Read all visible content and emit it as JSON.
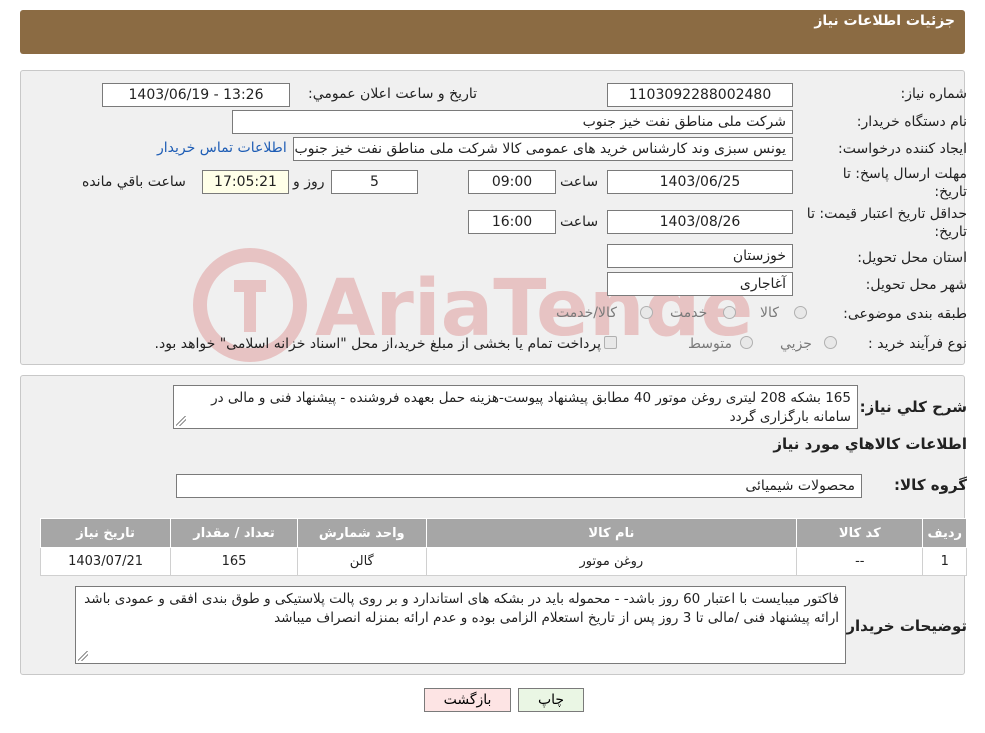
{
  "header": {
    "title": "جزئیات اطلاعات نیاز"
  },
  "form": {
    "need_number_label": "شماره نیاز:",
    "need_number": "1103092288002480",
    "announce_label": "تاریخ و ساعت اعلان عمومي:",
    "announce_value": "1403/06/19 - 13:26",
    "buyer_org_label": "نام دستگاه خريدار:",
    "buyer_org": "شركت ملی مناطق نفت خیز جنوب",
    "creator_label": "ايجاد كننده درخواست:",
    "creator": "یونس سبزی وند کارشناس خرید های عمومی کالا شركت ملی مناطق نفت خیز جنوب",
    "contact_link": "اطلاعات تماس خريدار",
    "deadline_label_1": "مهلت ارسال پاسخ: تا",
    "deadline_label_2": "تاريخ:",
    "deadline_date": "1403/06/25",
    "time_label": "ساعت",
    "deadline_time": "09:00",
    "days_value": "5",
    "days_label": "روز و",
    "remaining_time": "17:05:21",
    "remaining_label": "ساعت باقي مانده",
    "validity_label_1": "حداقل تاريخ اعتبار قيمت: تا",
    "validity_label_2": "تاريخ:",
    "validity_date": "1403/08/26",
    "validity_time": "16:00",
    "province_label": "استان محل تحويل:",
    "province": "خوزستان",
    "city_label": "شهر محل تحويل:",
    "city": "آغاجاری",
    "category_label": "طبقه بندی موضوعی:",
    "category_options": [
      "كالا",
      "خدمت",
      "كالا/خدمت"
    ],
    "process_label": "نوع فرآيند خريد :",
    "process_options": [
      "جزيي",
      "متوسط"
    ],
    "payment_note": "پرداخت تمام یا بخشی از مبلغ خرید،از محل \"اسناد خزانه اسلامی\" خواهد بود."
  },
  "details": {
    "summary_label": "شرح كلي نياز:",
    "summary": "165 بشکه 208 لیتری روغن موتور 40 مطابق پیشنهاد پیوست-هزینه حمل بعهده فروشنده - پیشنهاد فنی و مالی در سامانه بارگزاری گردد",
    "items_title": "اطلاعات كالاهاي مورد نياز",
    "group_label": "گروه كالا:",
    "group": "محصولات شیمیائی",
    "table": {
      "headers": [
        "رديف",
        "كد كالا",
        "نام كالا",
        "واحد شمارش",
        "تعداد / مقدار",
        "تاريخ نياز"
      ],
      "rows": [
        [
          "1",
          "--",
          "روغن موتور",
          "گالن",
          "165",
          "1403/07/21"
        ]
      ]
    },
    "buyer_notes_label": "توضيحات خريدار:",
    "buyer_notes": "فاکتور میبایست با اعتبار 60 روز باشد- - محموله باید در بشکه های استاندارد و بر روی پالت پلاستیکی و طوق بندی افقی و عمودی باشد ارائه پیشنهاد فنی /مالی تا 3 روز پس از تاریخ استعلام الزامی بوده و عدم ارائه بمنزله انصراف میباشد"
  },
  "buttons": {
    "print": "چاپ",
    "back": "بازگشت"
  },
  "watermark": {
    "text": "AriaTender.neT"
  }
}
